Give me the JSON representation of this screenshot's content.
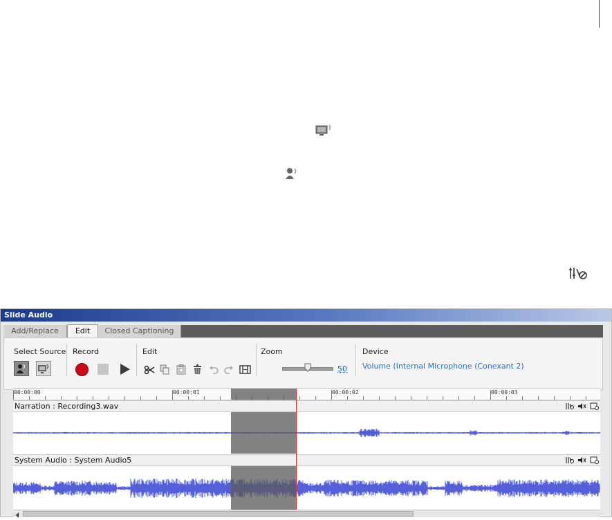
{
  "dialog": {
    "title": "Slide Audio",
    "tabs": [
      {
        "label": "Add/Replace",
        "active": false
      },
      {
        "label": "Edit",
        "active": true
      },
      {
        "label": "Closed Captioning",
        "active": false
      }
    ]
  },
  "toolbar": {
    "select_source_label": "Select Source",
    "record_label": "Record",
    "edit_label": "Edit",
    "zoom_label": "Zoom",
    "zoom_value": "50",
    "zoom_level": 0.5,
    "device_label": "Device",
    "device_value": "Volume (Internal Microphone (Conexant 2)"
  },
  "timeline": {
    "ruler_labels": [
      "00:00:00",
      "00:00:01",
      "00:00:02",
      "00:00:03"
    ],
    "tracks": [
      {
        "title": "Narration : Recording3.wav"
      },
      {
        "title": "System Audio : System Audio5"
      }
    ]
  },
  "colors": {
    "title_gradient_start": "#1a3c8c",
    "record": "#cc0b1a",
    "waveform": "#5560d8",
    "playhead": "#e23030",
    "link": "#2a6fb8"
  },
  "icons": {
    "floating": [
      "system-audio-icon",
      "narration-icon",
      "audio-settings-icon"
    ]
  }
}
